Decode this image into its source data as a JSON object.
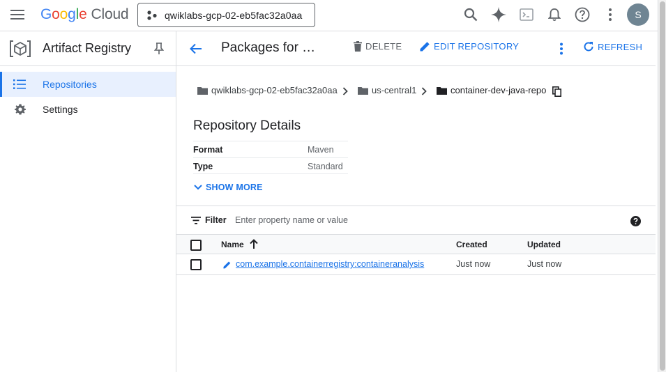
{
  "topbar": {
    "menu_icon": "hamburger-menu-icon",
    "logo": {
      "g1": "G",
      "o1": "o",
      "o2": "o",
      "g2": "g",
      "l": "l",
      "e": "e",
      "cloud": "Cloud"
    },
    "project": "qwiklabs-gcp-02-eb5fac32a0aa",
    "avatar_letter": "S"
  },
  "leftnav": {
    "product_title": "Artifact Registry",
    "items": [
      {
        "label": "Repositories",
        "icon": "list-icon",
        "active": true
      },
      {
        "label": "Settings",
        "icon": "gear-icon",
        "active": false
      }
    ]
  },
  "header": {
    "title": "Packages for …",
    "delete_label": "DELETE",
    "edit_label": "EDIT REPOSITORY",
    "refresh_label": "REFRESH"
  },
  "breadcrumb": {
    "project": "qwiklabs-gcp-02-eb5fac32a0aa",
    "location": "us-central1",
    "repository": "container-dev-java-repo"
  },
  "details": {
    "title": "Repository Details",
    "rows": [
      {
        "key": "Format",
        "value": "Maven"
      },
      {
        "key": "Type",
        "value": "Standard"
      }
    ],
    "show_more": "SHOW MORE"
  },
  "filter": {
    "label": "Filter",
    "placeholder": "Enter property name or value"
  },
  "table": {
    "columns": [
      "Name",
      "Created",
      "Updated"
    ],
    "rows": [
      {
        "name": "com.example.containerregistry:containeranalysis",
        "created": "Just now",
        "updated": "Just now"
      }
    ]
  },
  "colors": {
    "accent": "#1a73e8",
    "active_bg": "#e8f0fe",
    "border": "#dadce0"
  }
}
